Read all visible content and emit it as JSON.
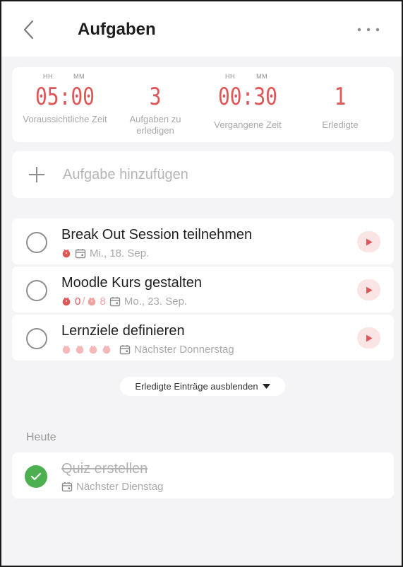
{
  "header": {
    "title": "Aufgaben",
    "back_icon": "chevron-left-icon",
    "more_icon": "more-horizontal-icon"
  },
  "stats": [
    {
      "hh": "HH",
      "mm": "MM",
      "value": "05:00",
      "label": "Voraussichtliche Zeit"
    },
    {
      "value": "3",
      "label": "Aufgaben zu erledigen"
    },
    {
      "hh": "HH",
      "mm": "MM",
      "value": "00:30",
      "label": "Vergangene Zeit"
    },
    {
      "value": "1",
      "label": "Erledigte"
    }
  ],
  "add_task": {
    "label": "Aufgabe hinzufügen"
  },
  "tasks": [
    {
      "name": "Break Out Session teilnehmen",
      "date": "Mi., 18. Sep."
    },
    {
      "name": "Moodle Kurs gestalten",
      "pomodoro_done": "0",
      "separator": "/",
      "pomodoro_total": "8",
      "date": "Mo., 23. Sep."
    },
    {
      "name": "Lernziele definieren",
      "pomodoro_estimate": 4,
      "date": "Nächster Donnerstag"
    }
  ],
  "toggle_completed": {
    "label": "Erledigte Einträge ausblenden"
  },
  "section_today": {
    "title": "Heute"
  },
  "completed": [
    {
      "name": "Quiz erstellen",
      "date": "Nächster Dienstag"
    }
  ],
  "colors": {
    "accent": "#e05656",
    "accent_light": "#fbe4e4",
    "success": "#4caf50",
    "background": "#f4f4f6"
  }
}
